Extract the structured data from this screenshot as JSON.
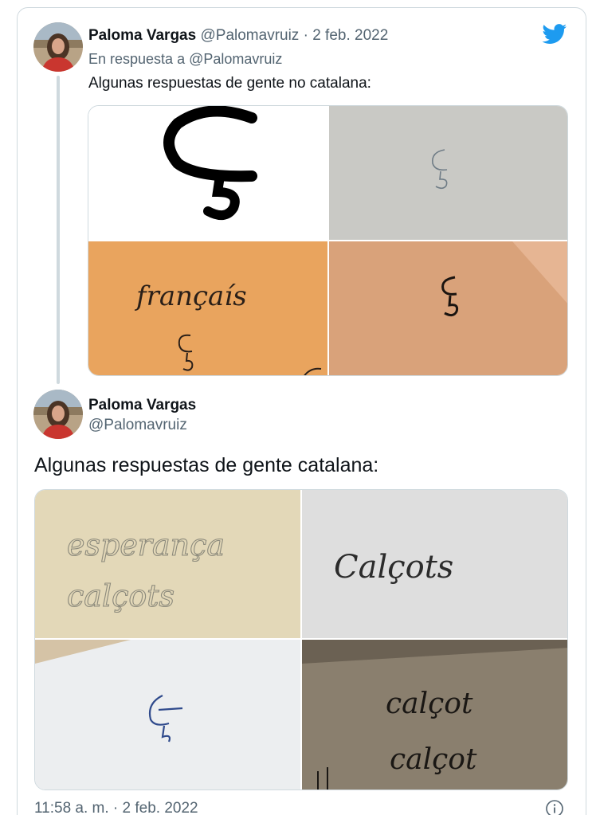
{
  "reply_tweet": {
    "name": "Paloma Vargas",
    "handle": "@Palomavruiz",
    "separator": "·",
    "date": "2 feb. 2022",
    "reply_prefix": "En respuesta a",
    "reply_mention": "@Palomavruiz",
    "text": "Algunas respuestas de gente no catalana:",
    "images": [
      {
        "caption": "",
        "background": "#ffffff"
      },
      {
        "caption": "",
        "background": "#c9c9c5"
      },
      {
        "caption": "françaís",
        "background": "#e9a45e"
      },
      {
        "caption": "",
        "background": "#d9a27a"
      }
    ]
  },
  "main_tweet": {
    "name": "Paloma Vargas",
    "handle": "@Palomavruiz",
    "text": "Algunas respuestas de gente catalana:",
    "images": [
      {
        "line1": "esperança",
        "line2": "calçots",
        "background": "#e3d8b8"
      },
      {
        "line1": "Calçots",
        "background": "#dedede"
      },
      {
        "line1": "",
        "background": "#eceef0"
      },
      {
        "line1": "calçot",
        "line2": "calçot",
        "background": "#8a7f6e"
      }
    ],
    "timestamp": "11:58 a. m. · 2 feb. 2022"
  },
  "icons": {
    "brand": "twitter-bird-icon",
    "info": "info-icon"
  },
  "colors": {
    "twitter_blue": "#1d9bf0",
    "text_primary": "#0f1419",
    "text_secondary": "#536471",
    "border": "#cfd9de"
  }
}
